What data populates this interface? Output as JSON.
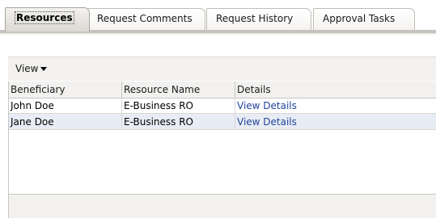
{
  "tabs": [
    {
      "label": "Resources",
      "active": true
    },
    {
      "label": "Request Comments",
      "active": false
    },
    {
      "label": "Request History",
      "active": false
    },
    {
      "label": "Approval Tasks",
      "active": false
    }
  ],
  "toolbar": {
    "view_label": "View"
  },
  "table": {
    "columns": [
      "Beneficiary",
      "Resource Name",
      "Details"
    ],
    "rows": [
      {
        "beneficiary": "John Doe",
        "resource_name": "E-Business RO",
        "details": "View Details"
      },
      {
        "beneficiary": "Jane Doe",
        "resource_name": "E-Business RO",
        "details": "View Details"
      }
    ]
  },
  "colors": {
    "link": "#21459c",
    "toolbar_bg": "#f2f1ef",
    "tab_active_bg": "#dcd9d4"
  }
}
